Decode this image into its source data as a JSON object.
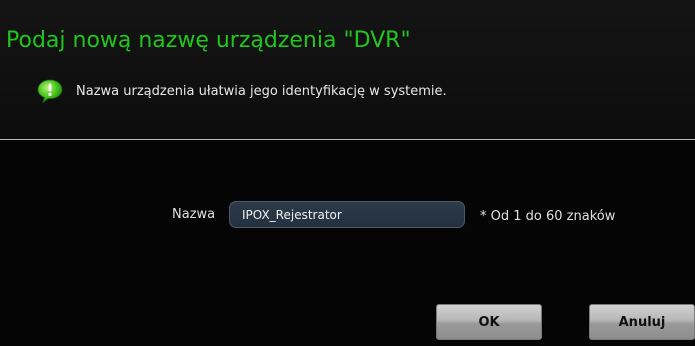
{
  "dialog": {
    "title": "Podaj nową nazwę urządzenia \"DVR\"",
    "info_icon": "info-bubble-icon",
    "info_text": "Nazwa urządzenia ułatwia jego identyfikację w systemie."
  },
  "form": {
    "name_label": "Nazwa",
    "name_value": "IPOX_Rejestrator",
    "name_hint": "* Od 1 do 60 znaków"
  },
  "buttons": {
    "ok_label": "OK",
    "cancel_label": "Anuluj"
  },
  "colors": {
    "title": "#22c51e",
    "background": "#050505",
    "icon_green": "#46c61a",
    "input_bg": "#26333f"
  }
}
